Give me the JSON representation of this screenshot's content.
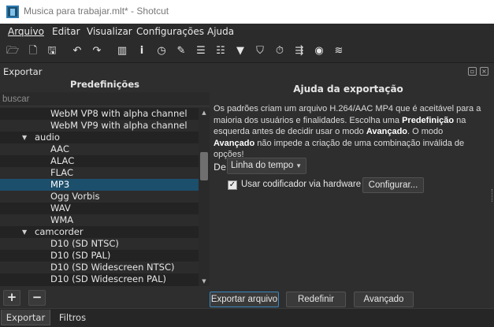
{
  "window": {
    "title": "Musica para trabajar.mlt* - Shotcut"
  },
  "menubar": {
    "items": [
      "Arquivo",
      "Editar",
      "Visualizar",
      "Configurações",
      "Ajuda"
    ]
  },
  "toolbar": {
    "icons": [
      "open-file-icon",
      "open-other-icon",
      "save-icon",
      "undo-icon",
      "redo-icon",
      "peak-meter-icon",
      "properties-icon",
      "recent-icon",
      "notes-icon",
      "playlist-icon",
      "timeline-icon",
      "filters-icon",
      "markers-icon",
      "keyframes-icon",
      "history-icon",
      "export-icon",
      "jobs-icon"
    ]
  },
  "dock": {
    "title": "Exportar"
  },
  "presets": {
    "header": "Predefinições",
    "search_placeholder": "buscar",
    "rows": [
      {
        "label": "WebM VP8 with alpha channel",
        "type": "item"
      },
      {
        "label": "WebM VP9 with alpha channel",
        "type": "item"
      },
      {
        "label": "audio",
        "type": "group"
      },
      {
        "label": "AAC",
        "type": "item"
      },
      {
        "label": "ALAC",
        "type": "item"
      },
      {
        "label": "FLAC",
        "type": "item"
      },
      {
        "label": "MP3",
        "type": "item",
        "selected": true
      },
      {
        "label": "Ogg Vorbis",
        "type": "item"
      },
      {
        "label": "WAV",
        "type": "item"
      },
      {
        "label": "WMA",
        "type": "item"
      },
      {
        "label": "camcorder",
        "type": "group"
      },
      {
        "label": "D10 (SD NTSC)",
        "type": "item"
      },
      {
        "label": "D10 (SD PAL)",
        "type": "item"
      },
      {
        "label": "D10 (SD Widescreen NTSC)",
        "type": "item"
      },
      {
        "label": "D10 (SD Widescreen PAL)",
        "type": "item"
      }
    ],
    "add_label": "+",
    "remove_label": "−"
  },
  "help": {
    "title": "Ajuda da exportação",
    "p1": "Os padrões criam um arquivo H.264/AAC MP4 que é aceitável para a maioria dos usuários e finalidades. Escolha uma ",
    "b1": "Predefinição",
    "p2": " na esquerda antes de decidir usar o modo ",
    "b2": "Avançado",
    "p3": ". O modo ",
    "b3": "Avançado",
    "p4": " não impede a criação de uma combinação inválida de opções!"
  },
  "source": {
    "label": "De",
    "value": "Linha do tempo"
  },
  "hardware": {
    "checked": true,
    "label": "Usar codificador via hardware",
    "configure_label": "Configurar..."
  },
  "actions": {
    "export_label": "Exportar arquivo",
    "reset_label": "Redefinir",
    "advanced_label": "Avançado"
  },
  "tabs": {
    "export": "Exportar",
    "filters": "Filtros"
  },
  "colors": {
    "selection": "#1c4f6b",
    "accent": "#3a88c0"
  }
}
